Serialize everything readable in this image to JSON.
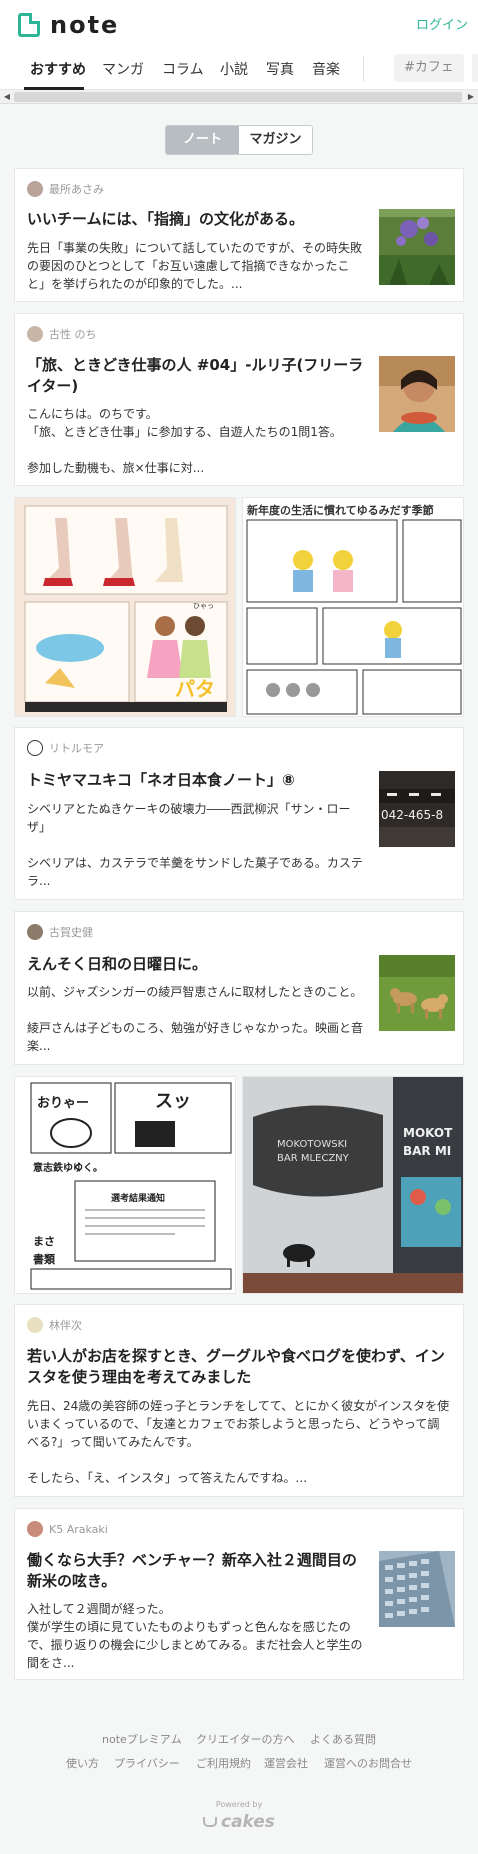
{
  "header": {
    "logo_text": "note",
    "login_label": "ログイン"
  },
  "tabs": [
    "おすすめ",
    "マンガ",
    "コラム",
    "小説",
    "写真",
    "音楽"
  ],
  "tag_label": "#カフェ",
  "switch": {
    "note": "ノート",
    "magazine": "マガジン"
  },
  "cards": [
    {
      "author": "最所あさみ",
      "title": "いいチームには、「指摘」の文化がある。",
      "body": [
        "先日「事業の失敗」について話していたのですが、その時失敗",
        "の要因のひとつとして「お互い遠慮して指摘できなかったこ",
        "と」を挙げられたのが印象的でした。..."
      ]
    },
    {
      "author": "古性 のち",
      "title": [
        "「旅、ときどき仕事の人 #04」-ルリ子(フリーラ",
        "イター)"
      ],
      "body": [
        "こんにちは。のちです。",
        "「旅、ときどき仕事」に参加する、自遊人たちの1問1答。",
        "",
        "参加した動機も、旅×仕事に対...",
        ""
      ]
    },
    {
      "author": "リトルモア",
      "title": "トミヤマユキコ「ネオ日本食ノート」⑧",
      "body": [
        "シベリアとたぬきケーキの破壊力――西武柳沢「サン・ロー",
        "ザ」",
        "",
        "シベリアは、カステラで羊羹をサンドした菓子である。カステ",
        "ラ..."
      ]
    },
    {
      "author": "古賀史健",
      "title": "えんそく日和の日曜日に。",
      "body": [
        "以前、ジャズシンガーの綾戸智恵さんに取材したときのこと。",
        "",
        "綾戸さんは子どものころ、勉強が好きじゃなかった。映画と音",
        "楽..."
      ]
    },
    {
      "author": "林伴次",
      "title": [
        "若い人がお店を探すとき、グーグルや食べログを使わず、イン",
        "スタを使う理由を考えてみました"
      ],
      "body": [
        "先日、24歳の美容師の姪っ子とランチをしてて、とにかく彼女がインスタを使",
        "いまくっているので、「友達とカフェでお茶しようと思ったら、どうやって調",
        "べる?」って聞いてみたんです。",
        "",
        "そしたら、「え、インスタ」って答えたんですね。..."
      ]
    },
    {
      "author": "K5 Arakaki",
      "title": [
        "働くなら大手？ベンチャー？新卒入社２週間目の",
        "新米の呟き。"
      ],
      "body": [
        "入社して２週間が経った。",
        "僕が学生の頃に見ていたものよりもずっと色んなを感じたの",
        "で、振り返りの機会に少しまとめてみる。まだ社会人と学生の",
        "間をさ..."
      ]
    }
  ],
  "tiles": {
    "sign_text": "042-465-8",
    "shop_line1": "MOKOTOWSKI",
    "shop_line2": "BAR MLECZNY",
    "shop_sign": "MOKOT",
    "shop_sign2": "BAR MI",
    "manga_title": "新年度の生活に慣れてゆるみだす季節",
    "notice_title": "選考結果通知",
    "kanji_a": "おりゃー",
    "kanji_b": "スッ",
    "kanji_c": "意志鉄ゆく",
    "kanji_d": "ゆく。",
    "kanji_e": "まさ",
    "kanji_f": "書類",
    "kanji_g": "パタ",
    "kanji_h": "ひゃっ"
  },
  "footer": {
    "row1": [
      "noteプレミアム",
      "クリエイターの方へ",
      "よくある質問"
    ],
    "row2": [
      "使い方",
      "プライバシー",
      "ご利用規約",
      "運営会社",
      "運営へのお問合せ"
    ],
    "powered": "Powered by",
    "brand": "cakes"
  },
  "colors": {
    "accent": "#2cb696",
    "background": "#f5f6f6"
  }
}
